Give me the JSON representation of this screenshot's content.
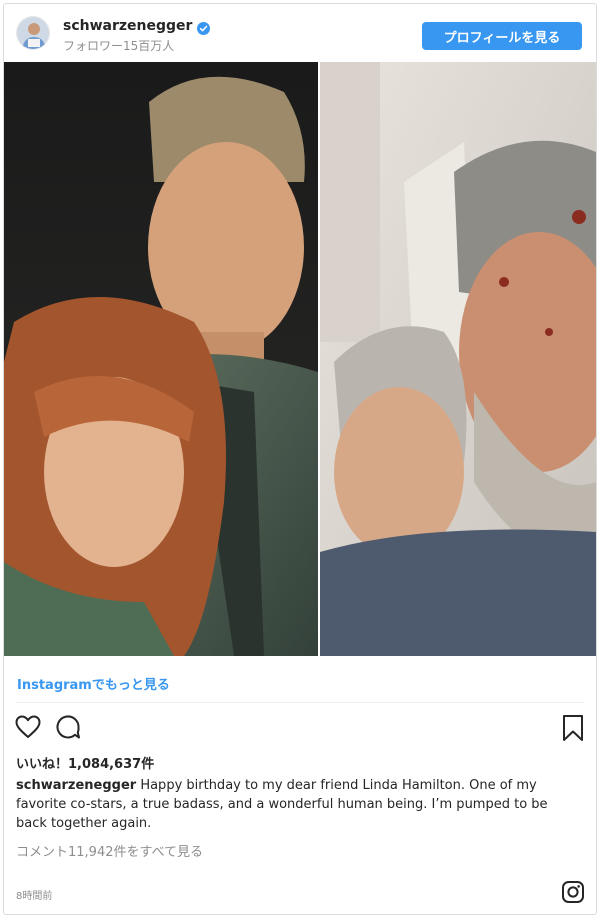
{
  "header": {
    "username": "schwarzenegger",
    "followers": "フォロワー15百万人",
    "profile_button": "プロフィールを見る"
  },
  "post": {
    "more_on_instagram": "Instagramでもっと見る",
    "likes": "いいね！1,084,637件",
    "caption_user": "schwarzenegger",
    "caption_text": " Happy birthday to my dear friend Linda Hamilton. One of my favorite co-stars, a true badass, and a wonderful human being. I’m pumped to be back together again.",
    "view_comments": "コメント11,942件をすべて見る",
    "timestamp": "8時間前"
  },
  "icons": {
    "verified": "verified-badge-icon",
    "like": "heart-icon",
    "comment": "comment-icon",
    "save": "bookmark-icon",
    "brand": "instagram-icon"
  },
  "colors": {
    "accent": "#3897f0",
    "muted": "#8e8e8e",
    "text": "#262626"
  }
}
